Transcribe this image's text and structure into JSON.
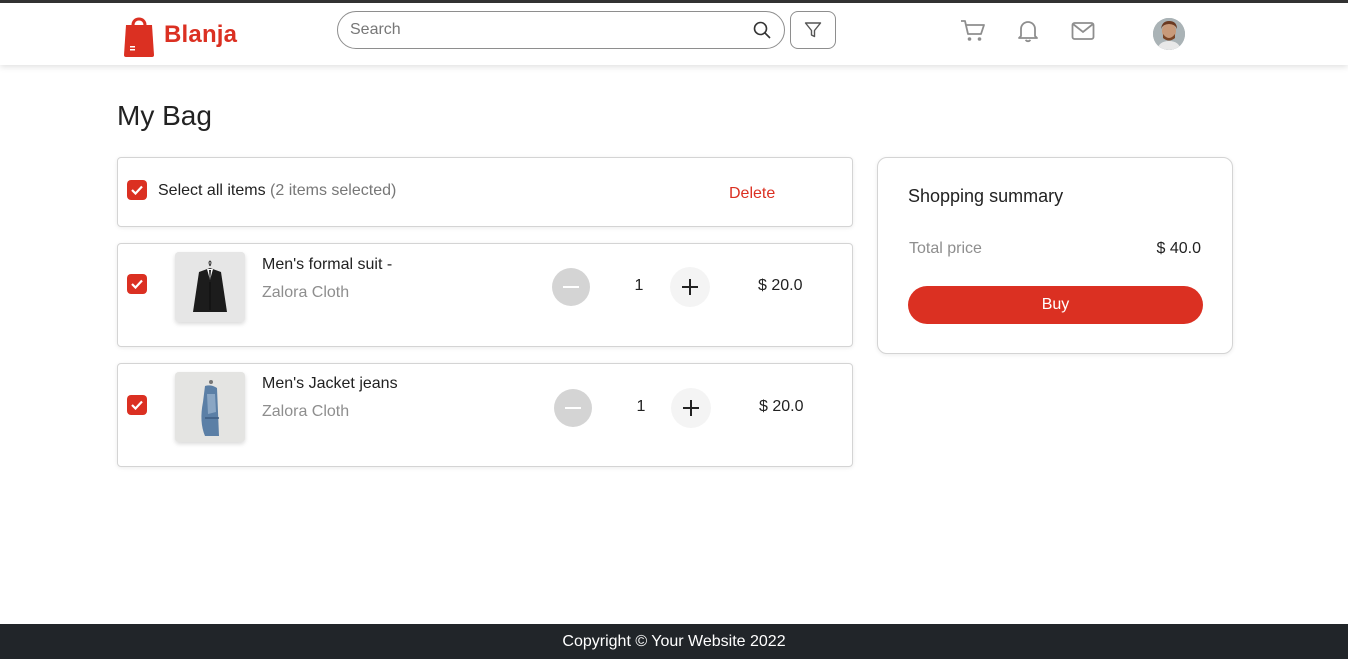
{
  "brand": {
    "name": "Blanja",
    "color": "#db3022"
  },
  "header": {
    "search_placeholder": "Search",
    "icons": [
      "search-icon",
      "filter-icon",
      "cart-icon",
      "bell-icon",
      "mail-icon",
      "avatar"
    ]
  },
  "page": {
    "title": "My Bag"
  },
  "selection": {
    "label": "Select all items",
    "count_text": "(2 items selected)",
    "checked": true,
    "delete_label": "Delete"
  },
  "cart": {
    "items": [
      {
        "name": "Men's formal suit -",
        "brand": "Zalora Cloth",
        "quantity": "1",
        "price": "$ 20.0",
        "checked": true,
        "image": "black-suit-jacket"
      },
      {
        "name": "Men's Jacket jeans",
        "brand": "Zalora Cloth",
        "quantity": "1",
        "price": "$ 20.0",
        "checked": true,
        "image": "denim-jacket"
      }
    ]
  },
  "summary": {
    "title": "Shopping summary",
    "total_label": "Total price",
    "total_value": "$ 40.0",
    "buy_label": "Buy"
  },
  "footer": {
    "text": "Copyright © Your Website 2022"
  },
  "colors": {
    "accent": "#db3022",
    "footer_bg": "#212529",
    "muted_text": "#8e8e8e"
  }
}
